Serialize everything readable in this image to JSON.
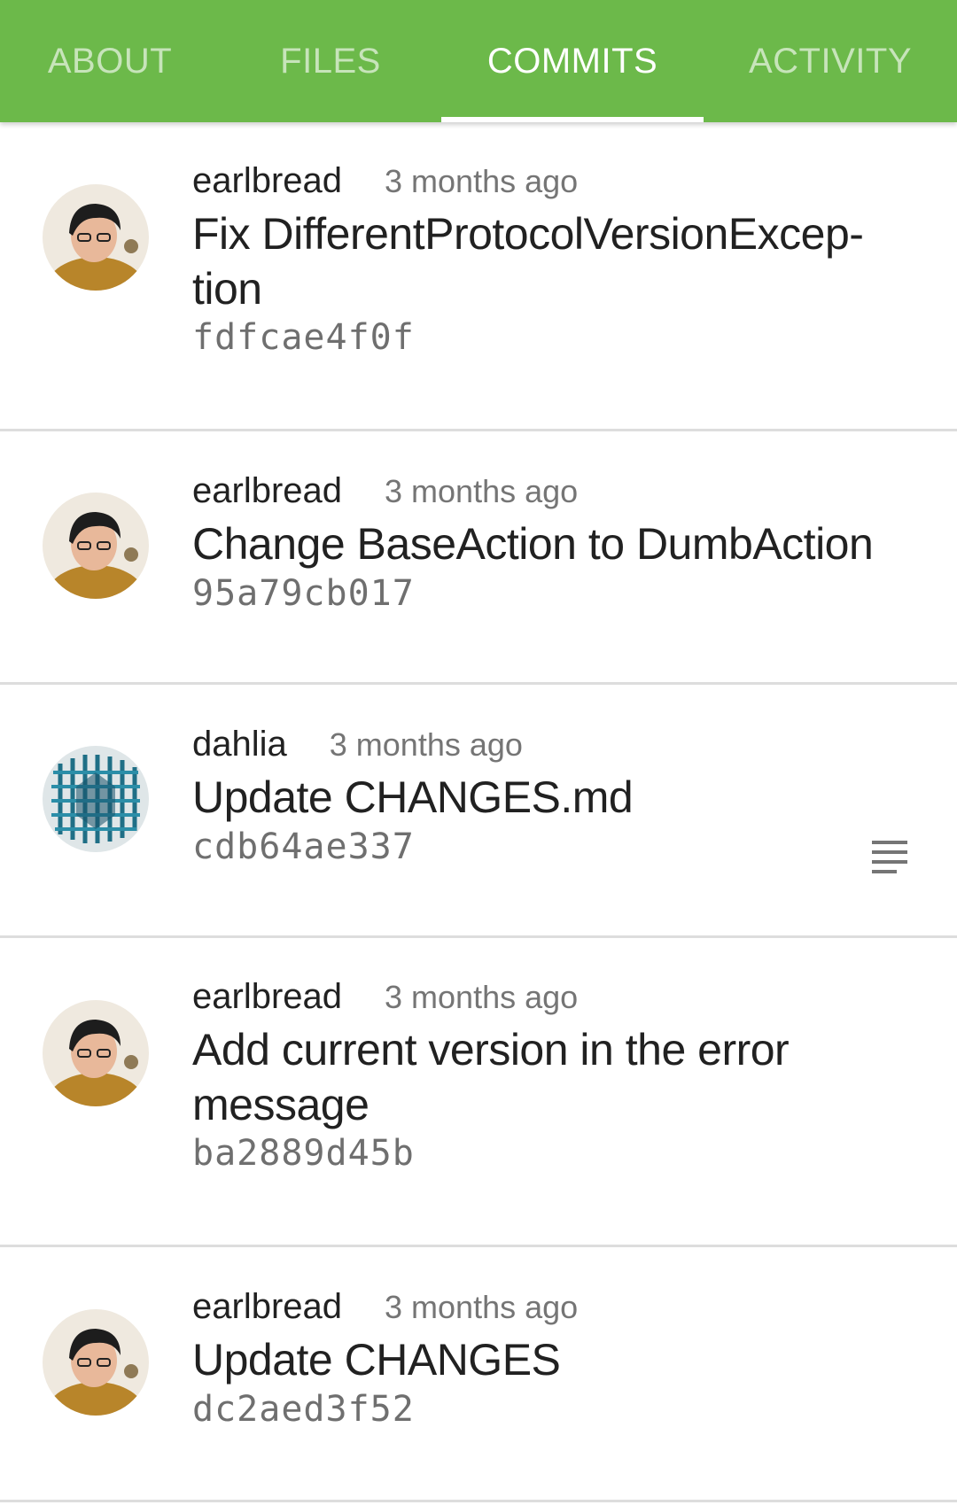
{
  "tabs": [
    {
      "label": "ABOUT",
      "active": false
    },
    {
      "label": "FILES",
      "active": false
    },
    {
      "label": "COMMITS",
      "active": true
    },
    {
      "label": "ACTIVITY",
      "active": false
    }
  ],
  "colors": {
    "app_bar": "#6cb94a",
    "text_primary": "#212121",
    "text_secondary": "#757575",
    "divider": "#dddddd"
  },
  "commits": [
    {
      "author": "earlbread",
      "time": "3 months ago",
      "message_line1": "Fix DifferentProtocolVersionExcep-",
      "message_line2": "tion",
      "sha": "fdfcae4f0f",
      "avatar": "person-photo"
    },
    {
      "author": "earlbread",
      "time": "3 months ago",
      "message_line1": "Change BaseAction to DumbAction",
      "message_line2": "",
      "sha": "95a79cb017",
      "avatar": "person-photo"
    },
    {
      "author": "dahlia",
      "time": "3 months ago",
      "message_line1": "Update CHANGES.md",
      "message_line2": "",
      "sha": "cdb64ae337",
      "avatar": "abstract-pattern",
      "has_description_icon": "subject-icon"
    },
    {
      "author": "earlbread",
      "time": "3 months ago",
      "message_line1": "Add current version in the error",
      "message_line2": "message",
      "sha": "ba2889d45b",
      "avatar": "person-photo"
    },
    {
      "author": "earlbread",
      "time": "3 months ago",
      "message_line1": "Update CHANGES",
      "message_line2": "",
      "sha": "dc2aed3f52",
      "avatar": "person-photo"
    }
  ]
}
